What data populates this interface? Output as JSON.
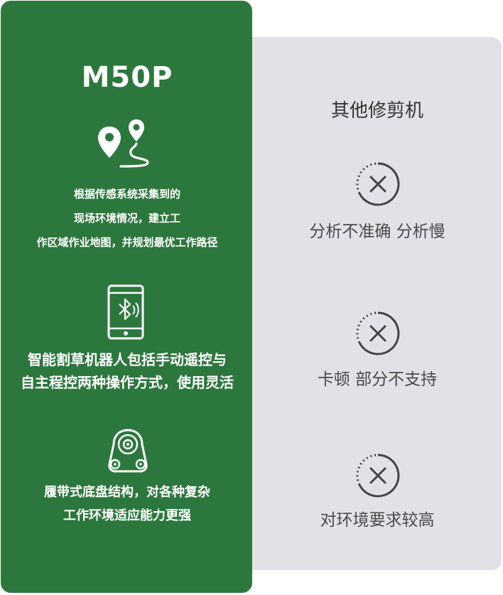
{
  "left": {
    "title": "M50P",
    "features": [
      {
        "icon": "map-route-icon",
        "lines": [
          "根据传感系统采集到的",
          "现场环境情况，建立工",
          "作区域作业地图，并规划最优工作路径"
        ]
      },
      {
        "icon": "phone-bluetooth-icon",
        "lines": [
          "智能割草机器人包括手动遥控与",
          "自主程控两种操作方式，使用灵活"
        ]
      },
      {
        "icon": "track-chassis-icon",
        "lines": [
          "履带式底盘结构，对各种复杂",
          "工作环境适应能力更强"
        ]
      }
    ]
  },
  "right": {
    "title": "其他修剪机",
    "items": [
      {
        "icon": "x-circle-icon",
        "text": "分析不准确 分析慢"
      },
      {
        "icon": "x-circle-icon",
        "text": "卡顿 部分不支持"
      },
      {
        "icon": "x-circle-icon",
        "text": "对环境要求较高"
      }
    ]
  },
  "colors": {
    "green": "#2c773d",
    "gray_panel": "#e2e1e7",
    "text_dark": "#333333"
  }
}
